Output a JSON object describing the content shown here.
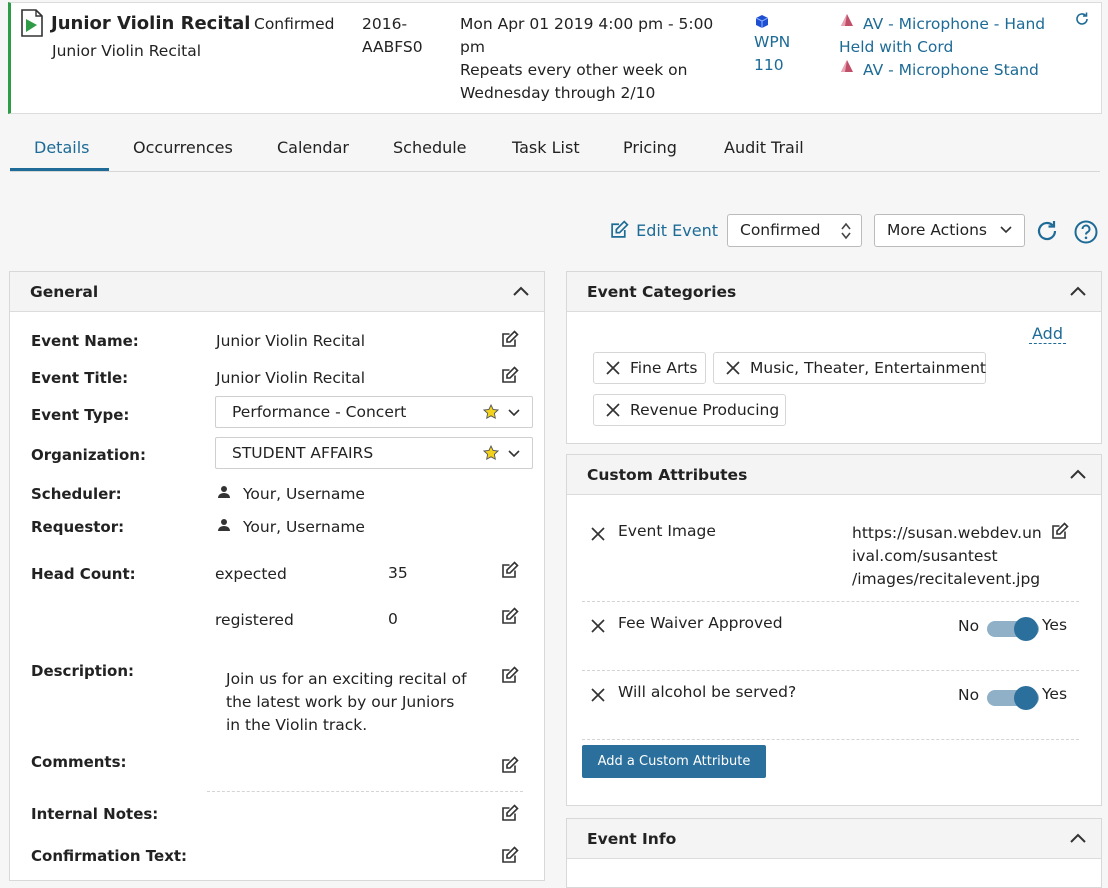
{
  "event_summary": {
    "name": "Junior Violin Recital",
    "title": "Junior Violin Recital",
    "status": "Confirmed",
    "reference_line1": "2016-",
    "reference_line2": "AABFS0",
    "datetime_line1": "Mon Apr 01 2019 4:00 pm - 5:00",
    "datetime_line2": "pm",
    "repeat_line1": "Repeats every other week on",
    "repeat_line2": "Wednesday through 2/10",
    "location_line1": "WPN",
    "location_line2": "110",
    "resource1_line1": "AV - Microphone - Hand",
    "resource1_line2": "Held with Cord",
    "resource2": "AV - Microphone Stand"
  },
  "tabs": [
    {
      "label": "Details",
      "active": true
    },
    {
      "label": "Occurrences"
    },
    {
      "label": "Calendar"
    },
    {
      "label": "Schedule"
    },
    {
      "label": "Task List"
    },
    {
      "label": "Pricing"
    },
    {
      "label": "Audit Trail"
    }
  ],
  "toolbar": {
    "edit_event_label": "Edit Event",
    "state_select_value": "Confirmed",
    "more_actions_label": "More Actions"
  },
  "general": {
    "title": "General",
    "event_name_label": "Event Name:",
    "event_name": "Junior Violin Recital",
    "event_title_label": "Event Title:",
    "event_title": "Junior Violin Recital",
    "event_type_label": "Event Type:",
    "event_type": "Performance - Concert",
    "organization_label": "Organization:",
    "organization": "STUDENT AFFAIRS",
    "scheduler_label": "Scheduler:",
    "scheduler": "Your, Username",
    "requestor_label": "Requestor:",
    "requestor": "Your, Username",
    "head_count_label": "Head Count:",
    "expected_label": "expected",
    "expected_value": "35",
    "registered_label": "registered",
    "registered_value": "0",
    "description_label": "Description:",
    "description_line1": "Join us for an exciting recital of",
    "description_line2": "the latest work by our Juniors",
    "description_line3": "in the Violin track.",
    "comments_label": "Comments:",
    "internal_notes_label": "Internal Notes:",
    "confirmation_text_label": "Confirmation Text:"
  },
  "event_categories": {
    "title": "Event Categories",
    "add_label": "Add",
    "items": [
      "Fine Arts",
      "Music, Theater, Entertainment",
      "Revenue Producing"
    ]
  },
  "custom_attributes": {
    "title": "Custom Attributes",
    "event_image_label": "Event Image",
    "event_image_line1": "https://susan.webdev.un",
    "event_image_line2": "ival.com/susantest",
    "event_image_line3": "/images/recitalevent.jpg",
    "fee_waiver_label": "Fee Waiver Approved",
    "alcohol_label": "Will alcohol be served?",
    "no_label": "No",
    "yes_label": "Yes",
    "add_button_label": "Add a Custom Attribute"
  },
  "event_info": {
    "title": "Event Info"
  },
  "colors": {
    "accent": "#1d6b96",
    "event_bar": "#2e9b47",
    "resource_icon": "#c0506a",
    "location_icon": "#1f4fd1"
  }
}
